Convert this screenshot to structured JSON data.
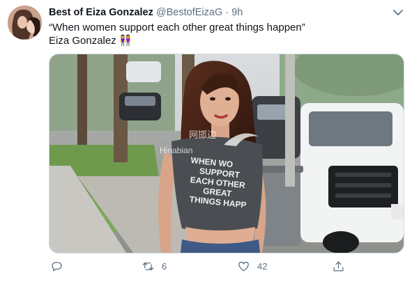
{
  "tweet": {
    "author_name": "Best of Eiza Gonzalez",
    "handle": "@BestofEizaG",
    "separator": "·",
    "time": "9h",
    "text_line1": "“When women support each other great things happen”",
    "text_line2": "Eiza Gonzalez",
    "emoji": "👭",
    "shirt_text": [
      "WHEN WO",
      "SUPPORT",
      "EACH OTHER",
      "GREAT",
      "THINGS HAPP"
    ],
    "watermark_cn": "网邯边",
    "watermark_en": "Hinabian"
  },
  "actions": {
    "reply_count": "",
    "retweet_count": "6",
    "like_count": "42"
  },
  "icons": {
    "reply": "reply-icon",
    "retweet": "retweet-icon",
    "like": "heart-icon",
    "share": "share-icon",
    "more": "chevron-down-icon"
  },
  "colors": {
    "secondary_text": "#5b7083",
    "border": "#cfd9de"
  }
}
